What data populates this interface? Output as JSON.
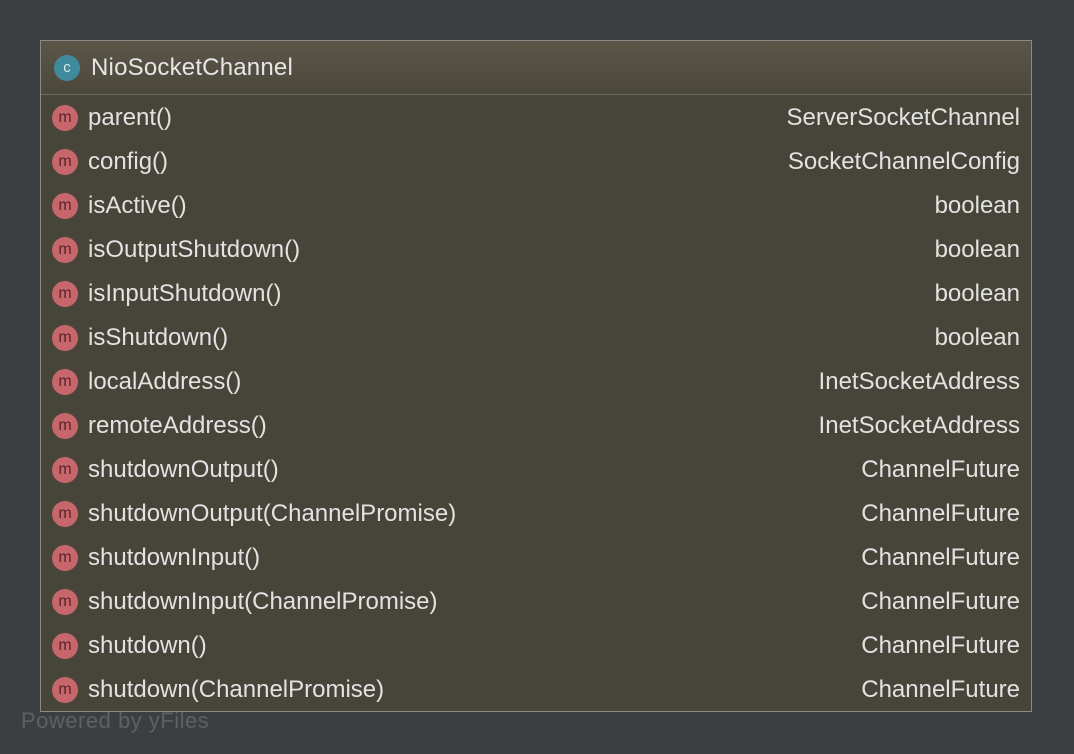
{
  "class_node": {
    "icon_letter": "c",
    "name": "NioSocketChannel",
    "methods": [
      {
        "icon_letter": "m",
        "name": "parent()",
        "type": "ServerSocketChannel"
      },
      {
        "icon_letter": "m",
        "name": "config()",
        "type": "SocketChannelConfig"
      },
      {
        "icon_letter": "m",
        "name": "isActive()",
        "type": "boolean"
      },
      {
        "icon_letter": "m",
        "name": "isOutputShutdown()",
        "type": "boolean"
      },
      {
        "icon_letter": "m",
        "name": "isInputShutdown()",
        "type": "boolean"
      },
      {
        "icon_letter": "m",
        "name": "isShutdown()",
        "type": "boolean"
      },
      {
        "icon_letter": "m",
        "name": "localAddress()",
        "type": "InetSocketAddress"
      },
      {
        "icon_letter": "m",
        "name": "remoteAddress()",
        "type": "InetSocketAddress"
      },
      {
        "icon_letter": "m",
        "name": "shutdownOutput()",
        "type": "ChannelFuture"
      },
      {
        "icon_letter": "m",
        "name": "shutdownOutput(ChannelPromise)",
        "type": "ChannelFuture"
      },
      {
        "icon_letter": "m",
        "name": "shutdownInput()",
        "type": "ChannelFuture"
      },
      {
        "icon_letter": "m",
        "name": "shutdownInput(ChannelPromise)",
        "type": "ChannelFuture"
      },
      {
        "icon_letter": "m",
        "name": "shutdown()",
        "type": "ChannelFuture"
      },
      {
        "icon_letter": "m",
        "name": "shutdown(ChannelPromise)",
        "type": "ChannelFuture"
      }
    ]
  },
  "watermark": "Powered by yFiles",
  "colors": {
    "background": "#3c3f41",
    "node_fill": "#47443a",
    "class_icon": "#3f8a9c",
    "method_icon": "#c7676b",
    "text": "#e2e2e2"
  }
}
